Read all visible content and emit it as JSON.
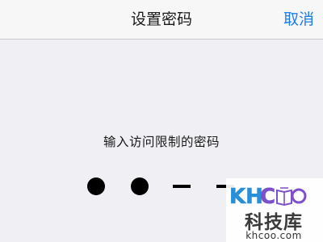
{
  "nav": {
    "title": "设置密码",
    "cancel_label": "取消"
  },
  "passcode": {
    "prompt": "输入访问限制的密码",
    "digits_entered": 2,
    "digits_total": 4
  },
  "watermark": {
    "logo_text": "KHCoo",
    "brand": "科技库",
    "url": "khcoo.com"
  },
  "colors": {
    "accent": "#1d7bf0",
    "background": "#efeff4",
    "nav_bar": "#f7f7f7",
    "watermark_blue": "#2a8fd6",
    "watermark_purple": "#7d4fc9"
  }
}
